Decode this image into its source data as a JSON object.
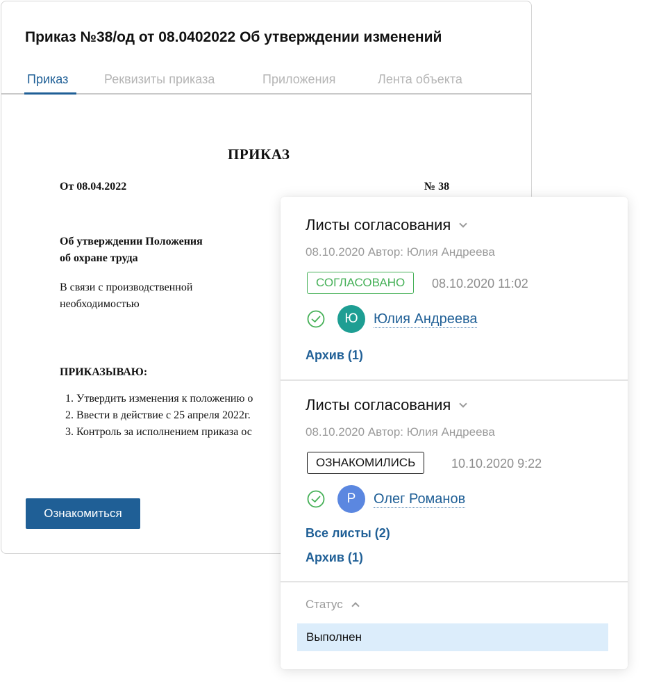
{
  "document": {
    "title": "Приказ №38/од от 08.0402022 Об утверждении изменений",
    "tabs": [
      {
        "label": "Приказ",
        "active": true
      },
      {
        "label": "Реквизиты приказа",
        "active": false
      },
      {
        "label": "Приложения",
        "active": false
      },
      {
        "label": "Лента объекта",
        "active": false
      }
    ],
    "heading": "ПРИКАЗ",
    "date_line": "От  08.04.2022",
    "number": "№ 38",
    "subject_line1": "Об утверждении Положения",
    "subject_line2": "об охране труда",
    "reason_line1": "В связи с производственной",
    "reason_line2": "необходимостью",
    "order_word": "ПРИКАЗЫВАЮ:",
    "items": [
      "1. Утвердить изменения к положению о",
      "2. Ввести в действие с 25 апреля 2022г.",
      "3. Контроль за исполнением приказа ос"
    ],
    "acquaint_button": "Ознакомиться"
  },
  "panel": {
    "sheets": [
      {
        "title": "Листы согласования",
        "meta": "08.10.2020 Автор: Юлия Андреева",
        "badge": "СОГЛАСОВАНО",
        "badge_color": "#45b057",
        "timestamp": "08.10.2020 11:02",
        "avatar_letter": "Ю",
        "avatar_color": "#1e9e93",
        "person": "Юлия Андреева",
        "archive": "Архив (1)"
      },
      {
        "title": "Листы согласования",
        "meta": "08.10.2020 Автор: Юлия Андреева",
        "badge": "ОЗНАКОМИЛИСЬ",
        "badge_color": "#111111",
        "timestamp": "10.10.2020 9:22",
        "avatar_letter": "Р",
        "avatar_color": "#5b87e0",
        "person": "Олег Романов",
        "all_sheets": "Все листы (2)",
        "archive": "Архив (1)"
      }
    ],
    "status": {
      "label": "Статус",
      "selected": "Выполнен"
    }
  },
  "colors": {
    "accent": "#1f5f96",
    "success": "#45b057",
    "selection": "#dcedfb"
  }
}
